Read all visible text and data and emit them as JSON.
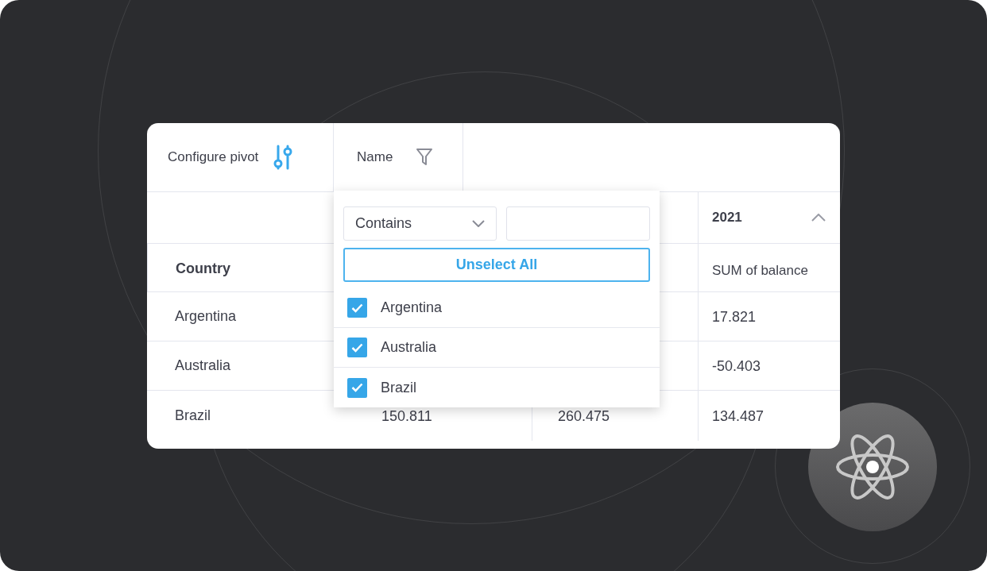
{
  "toolbar": {
    "configure_label": "Configure pivot",
    "field_label": "Name"
  },
  "filter": {
    "condition": "Contains",
    "unselect_label": "Unselect All",
    "items": [
      {
        "label": "Argentina",
        "checked": true
      },
      {
        "label": "Australia",
        "checked": true
      },
      {
        "label": "Brazil",
        "checked": true
      }
    ]
  },
  "table": {
    "column_4_header": "2021",
    "column_1_header": "Country",
    "column_4_subheader": "SUM of balance",
    "rows": [
      {
        "country": "Argentina",
        "column_4": "17.821"
      },
      {
        "country": "Australia",
        "column_4": "-50.403"
      },
      {
        "country": "Brazil",
        "column_2": "150.811",
        "column_3": "260.475",
        "column_4": "134.487"
      }
    ]
  }
}
